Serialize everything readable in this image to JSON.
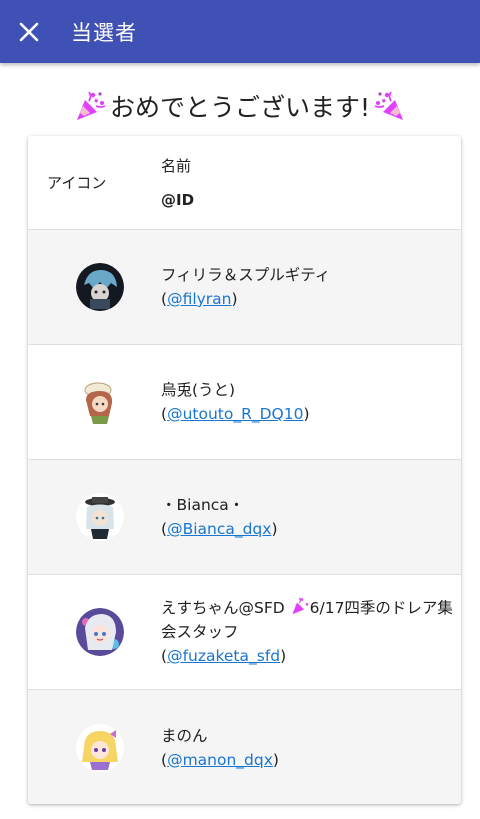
{
  "appbar": {
    "title": "当選者",
    "color": "#3f51b5"
  },
  "heading": {
    "text": "おめでとうございます!",
    "icon_left": "party-popper-icon",
    "icon_right": "party-popper-icon"
  },
  "table": {
    "header": {
      "icon_col": "アイコン",
      "name_col": "名前",
      "id_col": "@ID"
    },
    "rows": [
      {
        "name": "フィリラ＆スプルギティ",
        "id_prefix": "(",
        "id": "@filyran",
        "id_suffix": ")"
      },
      {
        "name": "烏兎(うと)",
        "id_prefix": "(",
        "id": "@utouto_R_DQ10",
        "id_suffix": ")"
      },
      {
        "name": "・Bianca・",
        "id_prefix": "(",
        "id": "@Bianca_dqx",
        "id_suffix": ")"
      },
      {
        "name_part1": "えすちゃん@SFD ",
        "name_part2": "6/17四季のドレア集会スタッフ",
        "id_prefix": "(",
        "id": "@fuzaketa_sfd",
        "id_suffix": ")"
      },
      {
        "name": "まのん",
        "id_prefix": "(",
        "id": "@manon_dqx",
        "id_suffix": ")"
      }
    ]
  },
  "colors": {
    "link": "#1976d2",
    "row_shade": "#f5f5f5"
  }
}
